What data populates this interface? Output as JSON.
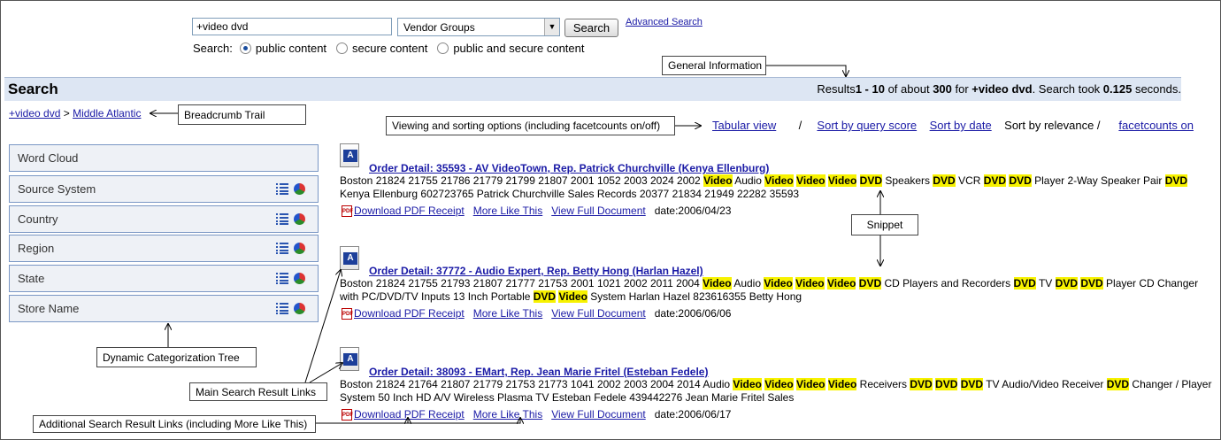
{
  "search": {
    "query": "+video dvd",
    "group_selected": "Vendor Groups",
    "button": "Search",
    "advanced": "Advanced Search",
    "scope_label": "Search:",
    "scope_options": [
      "public content",
      "secure content",
      "public and secure content"
    ]
  },
  "header": {
    "title": "Search",
    "stats_prefix": "Results",
    "range": "1 - 10",
    "of_about": " of about ",
    "total": "300",
    "for": " for ",
    "query": "+video dvd",
    "took": ". Search took ",
    "time": "0.125",
    "seconds": " seconds."
  },
  "breadcrumb": {
    "root": "+video dvd",
    "sep": " > ",
    "leaf": "Middle Atlantic"
  },
  "sort": {
    "tabular": "Tabular view",
    "slash1": "/",
    "by_score": "Sort by query score",
    "by_date": "Sort by date",
    "relevance": "Sort by relevance /",
    "facet": "facetcounts on"
  },
  "facets": [
    "Word Cloud",
    "Source System",
    "Country",
    "Region",
    "State",
    "Store Name"
  ],
  "callouts": {
    "general": "General Information",
    "breadcrumb": "Breadcrumb Trail",
    "viewing": "Viewing and sorting options (including facetcounts on/off)",
    "snippet": "Snippet",
    "tree": "Dynamic Categorization Tree",
    "main": "Main Search Result Links",
    "additional": "Additional Search Result Links (including More Like This)"
  },
  "result_links": {
    "pdf": "Download PDF Receipt",
    "more": "More Like This",
    "full": "View Full Document"
  },
  "results": [
    {
      "title": "Order Detail: 35593 - AV VideoTown, Rep. Patrick Churchville (Kenya Ellenburg)",
      "date": "date:2006/04/23",
      "lines": [
        [
          [
            "Boston 21824 21755 21786 21779 21799 21807 2001 1052 2003 2024 2002 ",
            0
          ],
          [
            "Video",
            1
          ],
          [
            " Audio ",
            0
          ],
          [
            "Video",
            1
          ],
          [
            " ",
            0
          ],
          [
            "Video",
            1
          ],
          [
            " ",
            0
          ],
          [
            "Video",
            1
          ],
          [
            " ",
            0
          ],
          [
            "DVD",
            1
          ],
          [
            " Speakers ",
            0
          ],
          [
            "DVD",
            1
          ],
          [
            " VCR ",
            0
          ],
          [
            "DVD",
            1
          ],
          [
            " ",
            0
          ],
          [
            "DVD",
            1
          ],
          [
            " Player 2-Way Speaker Pair ",
            0
          ],
          [
            "DVD",
            1
          ]
        ],
        [
          [
            "Kenya Ellenburg 602723765 Patrick Churchville Sales Records 20377 21834 21949 22282 35593",
            0
          ]
        ]
      ]
    },
    {
      "title": "Order Detail: 37772 - Audio Expert, Rep. Betty Hong (Harlan Hazel)",
      "date": "date:2006/06/06",
      "lines": [
        [
          [
            "Boston 21824 21755 21793 21807 21777 21753 2001 1021 2002 2011 2004 ",
            0
          ],
          [
            "Video",
            1
          ],
          [
            " Audio ",
            0
          ],
          [
            "Video",
            1
          ],
          [
            " ",
            0
          ],
          [
            "Video",
            1
          ],
          [
            " ",
            0
          ],
          [
            "Video",
            1
          ],
          [
            " ",
            0
          ],
          [
            "DVD",
            1
          ],
          [
            " CD Players and Recorders ",
            0
          ],
          [
            "DVD",
            1
          ],
          [
            " TV ",
            0
          ],
          [
            "DVD",
            1
          ],
          [
            " ",
            0
          ],
          [
            "DVD",
            1
          ],
          [
            " Player CD Changer",
            0
          ]
        ],
        [
          [
            "with PC/DVD/TV Inputs 13 Inch Portable ",
            0
          ],
          [
            "DVD",
            1
          ],
          [
            " ",
            0
          ],
          [
            "Video",
            1
          ],
          [
            " System Harlan Hazel 823616355 Betty Hong",
            0
          ]
        ]
      ]
    },
    {
      "title": "Order Detail: 38093 - EMart, Rep. Jean Marie Fritel (Esteban Fedele)",
      "date": "date:2006/06/17",
      "lines": [
        [
          [
            "Boston 21824 21764 21807 21779 21753 21773 1041 2002 2003 2004 2014 Audio ",
            0
          ],
          [
            "Video",
            1
          ],
          [
            " ",
            0
          ],
          [
            "Video",
            1
          ],
          [
            " ",
            0
          ],
          [
            "Video",
            1
          ],
          [
            " ",
            0
          ],
          [
            "Video",
            1
          ],
          [
            " Receivers ",
            0
          ],
          [
            "DVD",
            1
          ],
          [
            " ",
            0
          ],
          [
            "DVD",
            1
          ],
          [
            " ",
            0
          ],
          [
            "DVD",
            1
          ],
          [
            " TV Audio/Video Receiver ",
            0
          ],
          [
            "DVD",
            1
          ],
          [
            " Changer / Player",
            0
          ]
        ],
        [
          [
            "System 50 Inch HD A/V Wireless Plasma TV Esteban Fedele 439442276 Jean Marie Fritel Sales",
            0
          ]
        ]
      ]
    }
  ]
}
